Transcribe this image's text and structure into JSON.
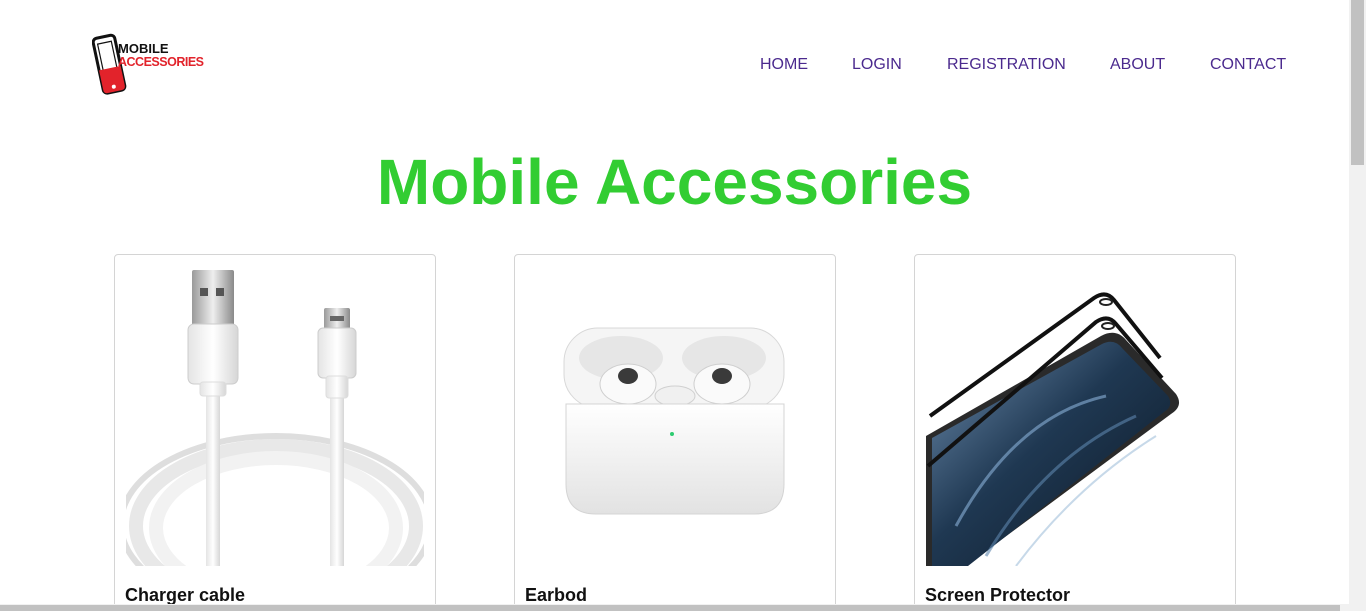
{
  "brand": {
    "logo_line1": "MOBILE",
    "logo_line2": "ACCESSORIES",
    "colors": {
      "dark": "#111111",
      "red": "#e2232b"
    }
  },
  "nav": {
    "items": [
      {
        "label": "HOME"
      },
      {
        "label": "LOGIN"
      },
      {
        "label": "REGISTRATION"
      },
      {
        "label": "ABOUT"
      },
      {
        "label": "CONTACT"
      }
    ],
    "color": "#4b2a8e"
  },
  "main": {
    "title": "Mobile Accessories",
    "title_color": "#32cd32",
    "products": [
      {
        "name": "Charger cable",
        "image": "usb-cable-image"
      },
      {
        "name": "Earbod",
        "image": "earbuds-case-image"
      },
      {
        "name": "Screen Protector",
        "image": "screen-protector-image"
      }
    ]
  }
}
